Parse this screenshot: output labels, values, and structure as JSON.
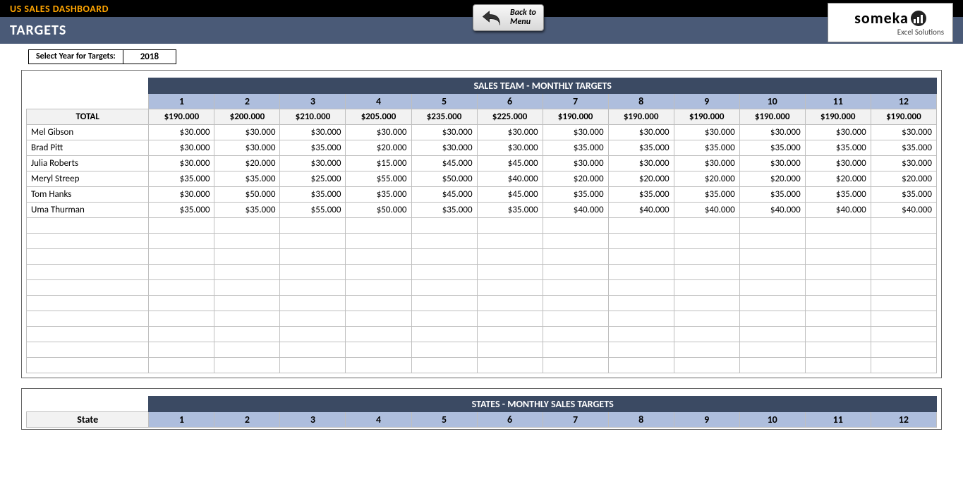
{
  "header": {
    "dashboard_title": "US SALES DASHBOARD",
    "section_title": "TARGETS",
    "back_label_line1": "Back to",
    "back_label_line2": "Menu",
    "logo_main": "someka",
    "logo_sub": "Excel Solutions"
  },
  "year_selector": {
    "label": "Select Year for Targets:",
    "value": "2018"
  },
  "months": [
    "1",
    "2",
    "3",
    "4",
    "5",
    "6",
    "7",
    "8",
    "9",
    "10",
    "11",
    "12"
  ],
  "table1": {
    "group_title": "SALES TEAM - MONTHLY TARGETS",
    "total_label": "TOTAL",
    "totals": [
      "$190.000",
      "$200.000",
      "$210.000",
      "$205.000",
      "$235.000",
      "$225.000",
      "$190.000",
      "$190.000",
      "$190.000",
      "$190.000",
      "$190.000",
      "$190.000"
    ],
    "rows": [
      {
        "name": "Mel Gibson",
        "vals": [
          "$30.000",
          "$30.000",
          "$30.000",
          "$30.000",
          "$30.000",
          "$30.000",
          "$30.000",
          "$30.000",
          "$30.000",
          "$30.000",
          "$30.000",
          "$30.000"
        ]
      },
      {
        "name": "Brad Pitt",
        "vals": [
          "$30.000",
          "$30.000",
          "$35.000",
          "$20.000",
          "$30.000",
          "$30.000",
          "$35.000",
          "$35.000",
          "$35.000",
          "$35.000",
          "$35.000",
          "$35.000"
        ]
      },
      {
        "name": "Julia Roberts",
        "vals": [
          "$30.000",
          "$20.000",
          "$30.000",
          "$15.000",
          "$45.000",
          "$45.000",
          "$30.000",
          "$30.000",
          "$30.000",
          "$30.000",
          "$30.000",
          "$30.000"
        ]
      },
      {
        "name": "Meryl Streep",
        "vals": [
          "$35.000",
          "$35.000",
          "$25.000",
          "$55.000",
          "$50.000",
          "$40.000",
          "$20.000",
          "$20.000",
          "$20.000",
          "$20.000",
          "$20.000",
          "$20.000"
        ]
      },
      {
        "name": "Tom Hanks",
        "vals": [
          "$30.000",
          "$50.000",
          "$35.000",
          "$35.000",
          "$45.000",
          "$45.000",
          "$35.000",
          "$35.000",
          "$35.000",
          "$35.000",
          "$35.000",
          "$35.000"
        ]
      },
      {
        "name": "Uma Thurman",
        "vals": [
          "$35.000",
          "$35.000",
          "$55.000",
          "$50.000",
          "$35.000",
          "$35.000",
          "$40.000",
          "$40.000",
          "$40.000",
          "$40.000",
          "$40.000",
          "$40.000"
        ]
      }
    ],
    "empty_rows": 10
  },
  "table2": {
    "group_title": "STATES - MONTHLY SALES TARGETS",
    "name_col_label": "State"
  }
}
